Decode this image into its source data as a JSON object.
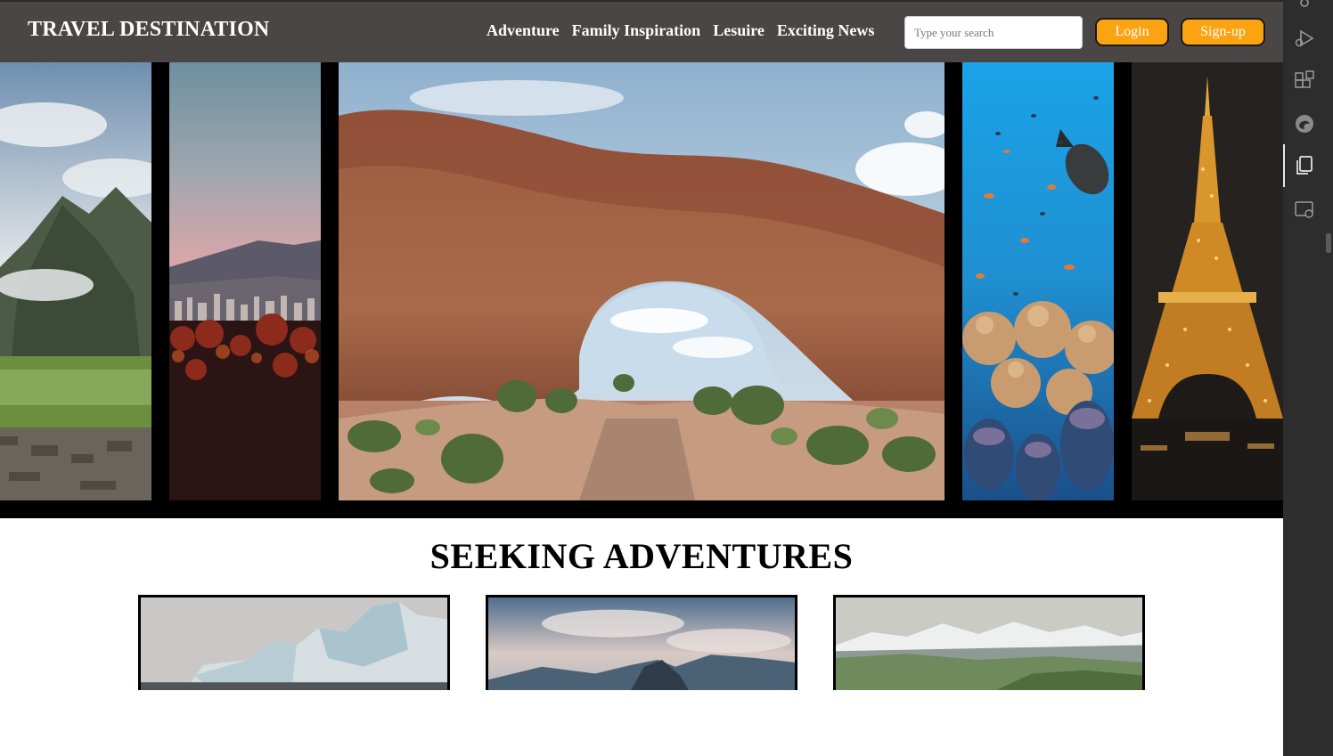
{
  "header": {
    "brand": "TRAVEL DESTINATION",
    "nav": [
      "Adventure",
      "Family Inspiration",
      "Lesuire",
      "Exciting News"
    ],
    "search_placeholder": "Type your search",
    "search_value": "",
    "login_label": "Login",
    "signup_label": "Sign-up"
  },
  "slider": {
    "slides": [
      "machu-picchu-image",
      "city-sunset-image",
      "rock-arch-image",
      "coral-reef-image",
      "eiffel-tower-image"
    ]
  },
  "section": {
    "title": "SEEKING ADVENTURES",
    "cards": [
      "glacier-image",
      "mountain-peak-image",
      "snowy-range-image"
    ]
  },
  "sidepanel": {
    "icons": [
      "settings-icon",
      "run-debug-icon",
      "extensions-icon",
      "edge-icon",
      "copy-files-icon",
      "remote-window-icon"
    ]
  },
  "colors": {
    "header_bg": "#4a4645",
    "button_bg": "#fca311",
    "slider_bg": "#000000",
    "panel_bg": "#2d2d2d"
  }
}
